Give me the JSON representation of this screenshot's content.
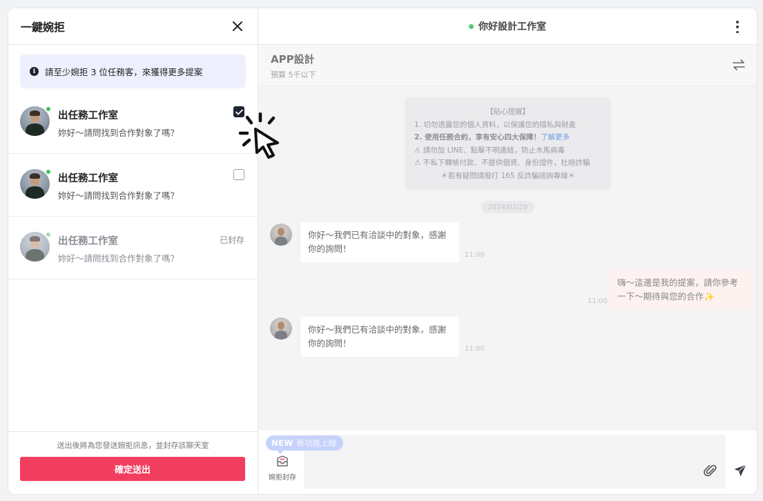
{
  "left_panel": {
    "title": "一鍵婉拒",
    "notice": "請至少婉拒 3 位任務客，來獲得更多提案",
    "items": [
      {
        "name": "出任務工作室",
        "preview": "妳好～請問找到合作對象了嗎？",
        "checked": true
      },
      {
        "name": "出任務工作室",
        "preview": "妳好～請問找到合作對象了嗎？",
        "checked": false
      },
      {
        "name": "出任務工作室",
        "preview": "妳好～請問找到合作對象了嗎？",
        "status": "已封存"
      }
    ],
    "footer_note": "送出後將為您發送婉拒訊息，並封存該聊天室",
    "confirm_label": "確定送出"
  },
  "right_panel": {
    "studio_name": "你好設計工作室",
    "project_title": "APP設計",
    "project_budget": "預算 5千以下",
    "tips": {
      "heading": "【貼心提醒】",
      "line1": "1. 切勿透露您的個人資料，以保護您的隱私與財產",
      "line2_strong": "2. 使用任務合約，享有安心四大保障！",
      "line2_link": "了解更多",
      "line3": "⚠ 請勿加 LINE、點擊不明連結，防止木馬病毒",
      "line4": "⚠ 不私下轉帳付款、不提供個資、身份證件，杜絕詐騙",
      "line5": "＊若有疑問請撥打 165 反詐騙諮詢專線＊"
    },
    "date": "2024/02/29",
    "messages": [
      {
        "text": "你好～我們已有洽談中的對象，感謝你的詢問！",
        "time": "11:00"
      },
      {
        "text": "嗨～這邊是我的提案，請你參考一下～期待與您的合作",
        "time": "11:00"
      },
      {
        "text": "你好～我們已有洽談中的對象，感謝你的詢問！",
        "time": "11:00"
      }
    ],
    "composer": {
      "badge_new": "NEW",
      "badge_text": "新功能上線",
      "decline_archive_label": "婉拒封存"
    }
  },
  "colors": {
    "confirm": "#f23e5e",
    "online": "#3fc55a",
    "checkbox_checked": "#1d2433",
    "badge": "#c7d2fb",
    "link": "#6f9ee8"
  }
}
